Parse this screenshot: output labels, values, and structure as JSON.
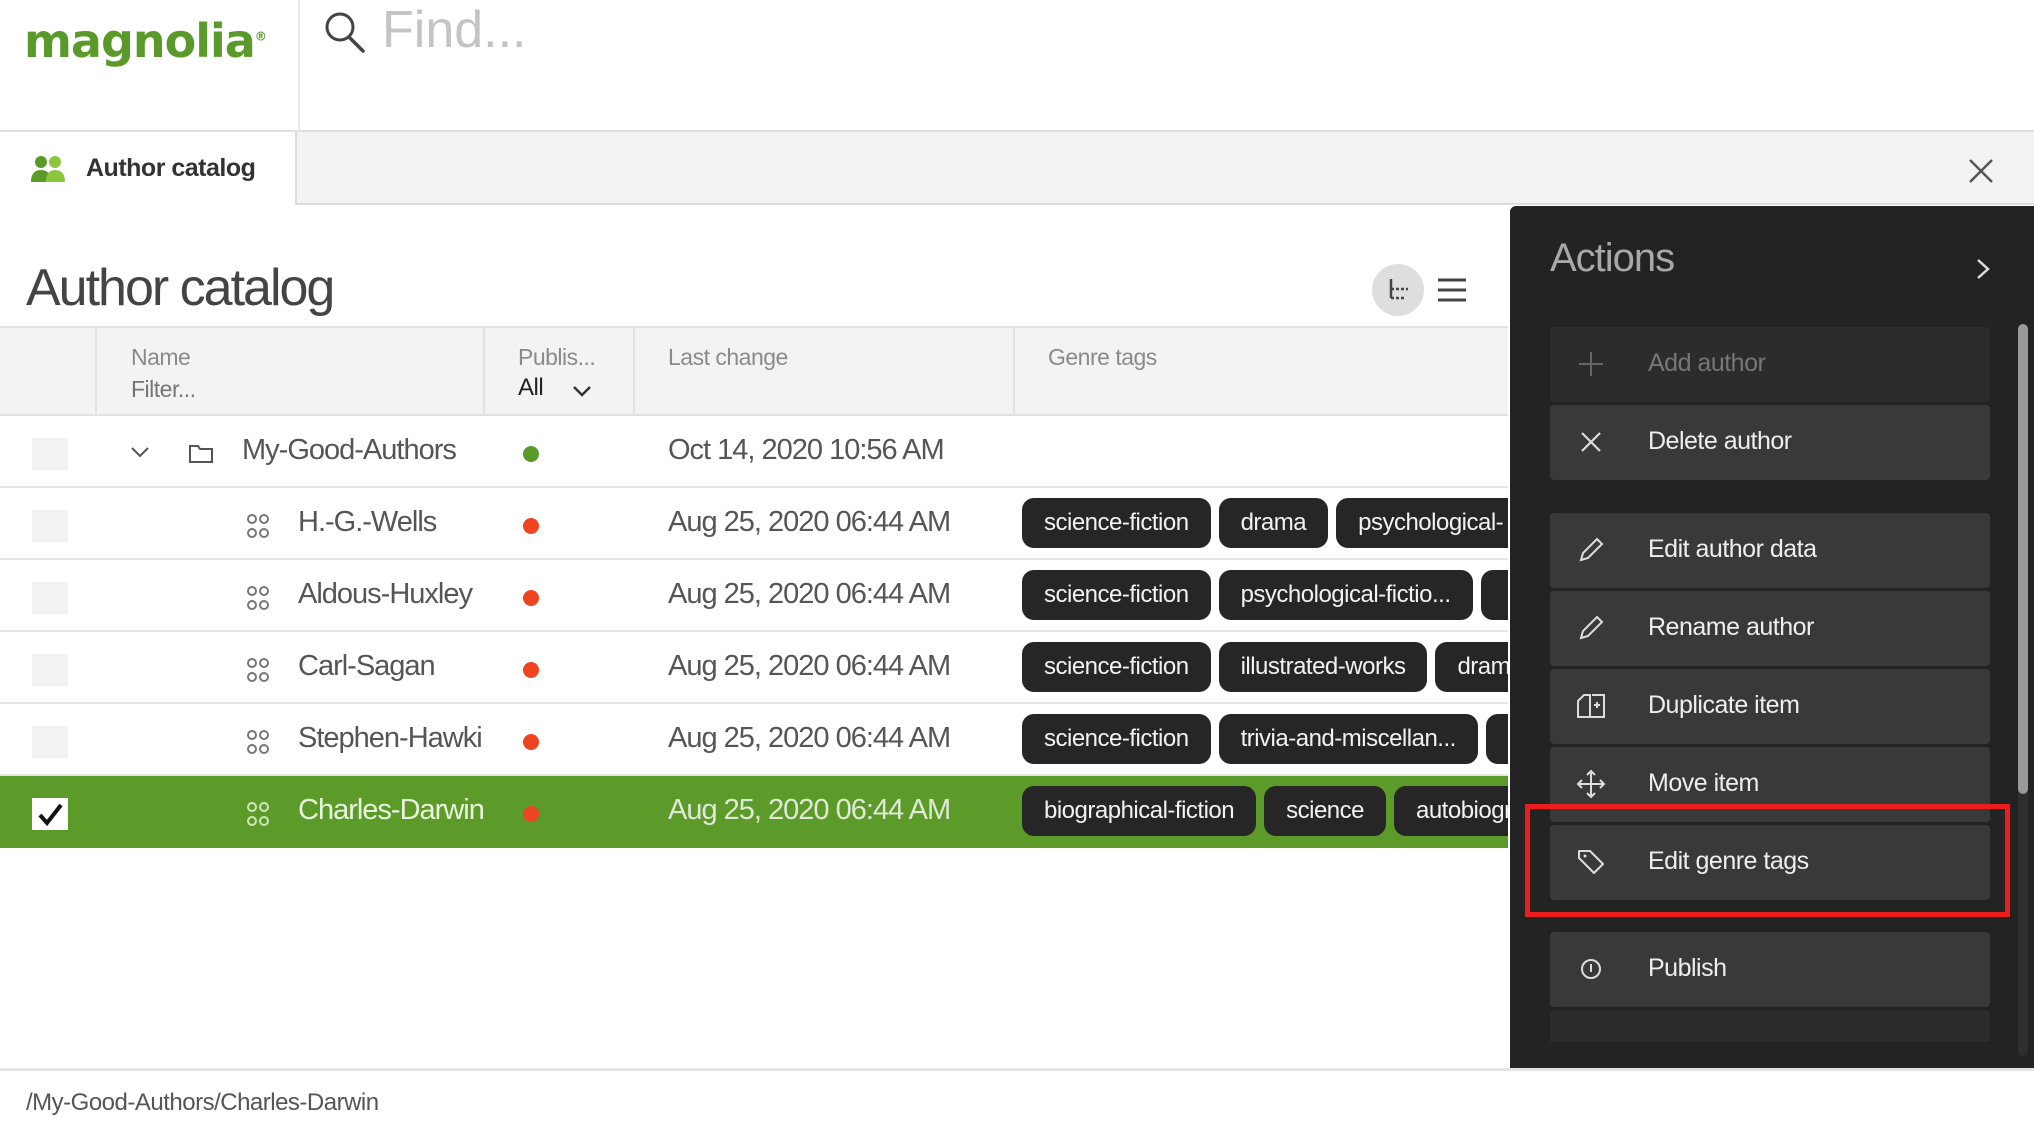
{
  "app": {
    "logo_text": "magnolia",
    "logo_mark": "®",
    "search_placeholder": "Find..."
  },
  "tabs": [
    {
      "label": "Author catalog",
      "icon": "users-icon",
      "active": true
    }
  ],
  "main": {
    "title": "Author catalog",
    "view_toggles": [
      "tree-view-icon",
      "list-view-icon"
    ]
  },
  "table": {
    "columns": {
      "name": {
        "label": "Name",
        "filter_placeholder": "Filter..."
      },
      "status": {
        "label": "Publis...",
        "filter_value": "All"
      },
      "last_change": {
        "label": "Last change"
      },
      "genre_tags": {
        "label": "Genre tags"
      }
    },
    "rows": [
      {
        "type": "folder",
        "name": "My-Good-Authors",
        "status": "published",
        "last_change": "Oct 14, 2020 10:56 AM",
        "tags": [],
        "checked": false,
        "expanded": true
      },
      {
        "type": "item",
        "name": "H.-G.-Wells",
        "status": "modified",
        "last_change": "Aug 25, 2020 06:44 AM",
        "tags": [
          "science-fiction",
          "drama",
          "psychological-"
        ],
        "checked": false
      },
      {
        "type": "item",
        "name": "Aldous-Huxley",
        "status": "modified",
        "last_change": "Aug 25, 2020 06:44 AM",
        "tags": [
          "science-fiction",
          "psychological-fictio...",
          ""
        ],
        "checked": false
      },
      {
        "type": "item",
        "name": "Carl-Sagan",
        "status": "modified",
        "last_change": "Aug 25, 2020 06:44 AM",
        "tags": [
          "science-fiction",
          "illustrated-works",
          "drama"
        ],
        "checked": false
      },
      {
        "type": "item",
        "name": "Stephen-Hawking",
        "status": "modified",
        "last_change": "Aug 25, 2020 06:44 AM",
        "tags": [
          "science-fiction",
          "trivia-and-miscellan...",
          ""
        ],
        "checked": false
      },
      {
        "type": "item",
        "name": "Charles-Darwin",
        "status": "modified",
        "last_change": "Aug 25, 2020 06:44 AM",
        "tags": [
          "biographical-fiction",
          "science",
          "autobiography"
        ],
        "checked": true,
        "selected": true
      }
    ]
  },
  "colors": {
    "brand_green": "#5c9a2a",
    "status_published": "#5a9a2a",
    "status_modified": "#ee4422",
    "highlight_red": "#ee1c1c"
  },
  "actions": {
    "title": "Actions",
    "items": [
      {
        "label": "Add author",
        "icon": "plus-icon",
        "disabled": true
      },
      {
        "label": "Delete author",
        "icon": "close-icon",
        "disabled": false
      },
      {
        "label": "Edit author data",
        "icon": "pencil-icon",
        "disabled": false
      },
      {
        "label": "Rename author",
        "icon": "pencil-icon",
        "disabled": false
      },
      {
        "label": "Duplicate item",
        "icon": "duplicate-icon",
        "disabled": false
      },
      {
        "label": "Move item",
        "icon": "move-icon",
        "disabled": false
      },
      {
        "label": "Edit genre tags",
        "icon": "tag-icon",
        "disabled": false,
        "highlighted": true
      },
      {
        "label": "Publish",
        "icon": "publish-icon",
        "disabled": false
      }
    ]
  },
  "footer": {
    "path": "/My-Good-Authors/Charles-Darwin"
  }
}
